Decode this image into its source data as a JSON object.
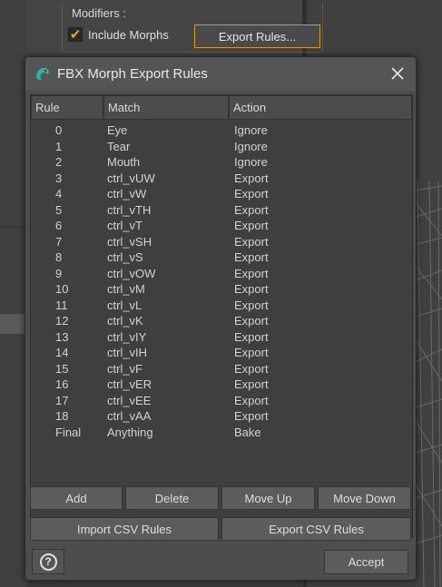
{
  "background": {
    "group_label": "Modifiers :",
    "include_morphs_label": "Include Morphs",
    "include_morphs_checked": true,
    "export_rules_button": "Export Rules..."
  },
  "dialog": {
    "title": "FBX Morph Export Rules",
    "icon": "daz-logo-icon",
    "close_icon": "close-icon",
    "columns": [
      "Rule",
      "Match",
      "Action"
    ],
    "rows": [
      {
        "rule": "0",
        "match": "Eye",
        "action": "Ignore"
      },
      {
        "rule": "1",
        "match": "Tear",
        "action": "Ignore"
      },
      {
        "rule": "2",
        "match": "Mouth",
        "action": "Ignore"
      },
      {
        "rule": "3",
        "match": "ctrl_vUW",
        "action": "Export"
      },
      {
        "rule": "4",
        "match": "ctrl_vW",
        "action": "Export"
      },
      {
        "rule": "5",
        "match": "ctrl_vTH",
        "action": "Export"
      },
      {
        "rule": "6",
        "match": "ctrl_vT",
        "action": "Export"
      },
      {
        "rule": "7",
        "match": "ctrl_vSH",
        "action": "Export"
      },
      {
        "rule": "8",
        "match": "ctrl_vS",
        "action": "Export"
      },
      {
        "rule": "9",
        "match": "ctrl_vOW",
        "action": "Export"
      },
      {
        "rule": "10",
        "match": "ctrl_vM",
        "action": "Export"
      },
      {
        "rule": "11",
        "match": "ctrl_vL",
        "action": "Export"
      },
      {
        "rule": "12",
        "match": "ctrl_vK",
        "action": "Export"
      },
      {
        "rule": "13",
        "match": "ctrl_vIY",
        "action": "Export"
      },
      {
        "rule": "14",
        "match": "ctrl_vIH",
        "action": "Export"
      },
      {
        "rule": "15",
        "match": "ctrl_vF",
        "action": "Export"
      },
      {
        "rule": "16",
        "match": "ctrl_vER",
        "action": "Export"
      },
      {
        "rule": "17",
        "match": "ctrl_vEE",
        "action": "Export"
      },
      {
        "rule": "18",
        "match": "ctrl_vAA",
        "action": "Export"
      },
      {
        "rule": "Final",
        "match": "Anything",
        "action": "Bake"
      }
    ],
    "buttons": {
      "add": "Add",
      "delete": "Delete",
      "move_up": "Move Up",
      "move_down": "Move Down",
      "import_csv": "Import CSV Rules",
      "export_csv": "Export CSV Rules",
      "accept": "Accept",
      "help": "?"
    }
  },
  "colors": {
    "accent": "#d89b1c",
    "dialog_bg": "#4d4d4d",
    "table_bg": "#3f3f3f"
  }
}
